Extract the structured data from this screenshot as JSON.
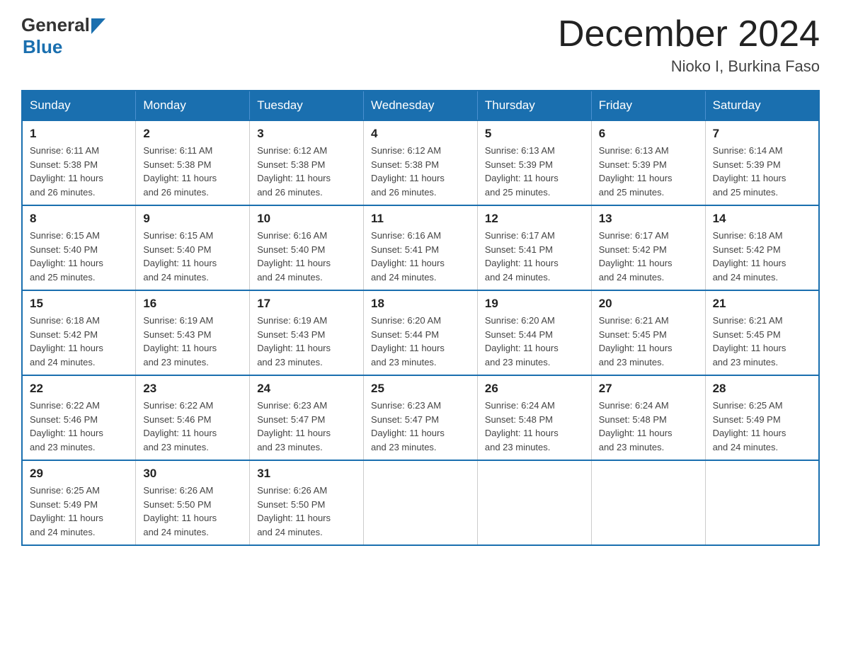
{
  "header": {
    "logo_general": "General",
    "logo_blue": "Blue",
    "month_year": "December 2024",
    "location": "Nioko I, Burkina Faso"
  },
  "days_of_week": [
    "Sunday",
    "Monday",
    "Tuesday",
    "Wednesday",
    "Thursday",
    "Friday",
    "Saturday"
  ],
  "weeks": [
    [
      {
        "day": "1",
        "sunrise": "6:11 AM",
        "sunset": "5:38 PM",
        "daylight": "11 hours and 26 minutes."
      },
      {
        "day": "2",
        "sunrise": "6:11 AM",
        "sunset": "5:38 PM",
        "daylight": "11 hours and 26 minutes."
      },
      {
        "day": "3",
        "sunrise": "6:12 AM",
        "sunset": "5:38 PM",
        "daylight": "11 hours and 26 minutes."
      },
      {
        "day": "4",
        "sunrise": "6:12 AM",
        "sunset": "5:38 PM",
        "daylight": "11 hours and 26 minutes."
      },
      {
        "day": "5",
        "sunrise": "6:13 AM",
        "sunset": "5:39 PM",
        "daylight": "11 hours and 25 minutes."
      },
      {
        "day": "6",
        "sunrise": "6:13 AM",
        "sunset": "5:39 PM",
        "daylight": "11 hours and 25 minutes."
      },
      {
        "day": "7",
        "sunrise": "6:14 AM",
        "sunset": "5:39 PM",
        "daylight": "11 hours and 25 minutes."
      }
    ],
    [
      {
        "day": "8",
        "sunrise": "6:15 AM",
        "sunset": "5:40 PM",
        "daylight": "11 hours and 25 minutes."
      },
      {
        "day": "9",
        "sunrise": "6:15 AM",
        "sunset": "5:40 PM",
        "daylight": "11 hours and 24 minutes."
      },
      {
        "day": "10",
        "sunrise": "6:16 AM",
        "sunset": "5:40 PM",
        "daylight": "11 hours and 24 minutes."
      },
      {
        "day": "11",
        "sunrise": "6:16 AM",
        "sunset": "5:41 PM",
        "daylight": "11 hours and 24 minutes."
      },
      {
        "day": "12",
        "sunrise": "6:17 AM",
        "sunset": "5:41 PM",
        "daylight": "11 hours and 24 minutes."
      },
      {
        "day": "13",
        "sunrise": "6:17 AM",
        "sunset": "5:42 PM",
        "daylight": "11 hours and 24 minutes."
      },
      {
        "day": "14",
        "sunrise": "6:18 AM",
        "sunset": "5:42 PM",
        "daylight": "11 hours and 24 minutes."
      }
    ],
    [
      {
        "day": "15",
        "sunrise": "6:18 AM",
        "sunset": "5:42 PM",
        "daylight": "11 hours and 24 minutes."
      },
      {
        "day": "16",
        "sunrise": "6:19 AM",
        "sunset": "5:43 PM",
        "daylight": "11 hours and 23 minutes."
      },
      {
        "day": "17",
        "sunrise": "6:19 AM",
        "sunset": "5:43 PM",
        "daylight": "11 hours and 23 minutes."
      },
      {
        "day": "18",
        "sunrise": "6:20 AM",
        "sunset": "5:44 PM",
        "daylight": "11 hours and 23 minutes."
      },
      {
        "day": "19",
        "sunrise": "6:20 AM",
        "sunset": "5:44 PM",
        "daylight": "11 hours and 23 minutes."
      },
      {
        "day": "20",
        "sunrise": "6:21 AM",
        "sunset": "5:45 PM",
        "daylight": "11 hours and 23 minutes."
      },
      {
        "day": "21",
        "sunrise": "6:21 AM",
        "sunset": "5:45 PM",
        "daylight": "11 hours and 23 minutes."
      }
    ],
    [
      {
        "day": "22",
        "sunrise": "6:22 AM",
        "sunset": "5:46 PM",
        "daylight": "11 hours and 23 minutes."
      },
      {
        "day": "23",
        "sunrise": "6:22 AM",
        "sunset": "5:46 PM",
        "daylight": "11 hours and 23 minutes."
      },
      {
        "day": "24",
        "sunrise": "6:23 AM",
        "sunset": "5:47 PM",
        "daylight": "11 hours and 23 minutes."
      },
      {
        "day": "25",
        "sunrise": "6:23 AM",
        "sunset": "5:47 PM",
        "daylight": "11 hours and 23 minutes."
      },
      {
        "day": "26",
        "sunrise": "6:24 AM",
        "sunset": "5:48 PM",
        "daylight": "11 hours and 23 minutes."
      },
      {
        "day": "27",
        "sunrise": "6:24 AM",
        "sunset": "5:48 PM",
        "daylight": "11 hours and 23 minutes."
      },
      {
        "day": "28",
        "sunrise": "6:25 AM",
        "sunset": "5:49 PM",
        "daylight": "11 hours and 24 minutes."
      }
    ],
    [
      {
        "day": "29",
        "sunrise": "6:25 AM",
        "sunset": "5:49 PM",
        "daylight": "11 hours and 24 minutes."
      },
      {
        "day": "30",
        "sunrise": "6:26 AM",
        "sunset": "5:50 PM",
        "daylight": "11 hours and 24 minutes."
      },
      {
        "day": "31",
        "sunrise": "6:26 AM",
        "sunset": "5:50 PM",
        "daylight": "11 hours and 24 minutes."
      },
      null,
      null,
      null,
      null
    ]
  ],
  "labels": {
    "sunrise": "Sunrise:",
    "sunset": "Sunset:",
    "daylight": "Daylight:"
  }
}
